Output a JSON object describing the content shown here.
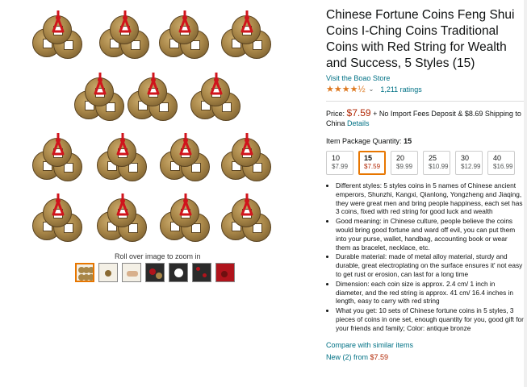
{
  "gallery": {
    "rollover_text": "Roll over image to zoom in",
    "thumbnails": [
      "coins-grid",
      "coin-closeup",
      "coin-hand",
      "coin-dark",
      "coin-yin-yang",
      "coin-scene",
      "coin-red"
    ]
  },
  "product": {
    "title": "Chinese Fortune Coins Feng Shui Coins I-Ching Coins Traditional Coins with Red String for Wealth and Success, 5 Styles (15)",
    "store_link": "Visit the Boao Store",
    "stars": "★★★★½",
    "rating_count": "1,211 ratings"
  },
  "price": {
    "label": "Price:",
    "amount": "$7.59",
    "shipping_text": "+ No Import Fees Deposit & $8.69 Shipping to China",
    "details_link": "Details"
  },
  "quantity": {
    "label": "Item Package Quantity:",
    "selected": "15",
    "options": [
      {
        "qty": "10",
        "price": "$7.99"
      },
      {
        "qty": "15",
        "price": "$7.59"
      },
      {
        "qty": "20",
        "price": "$9.99"
      },
      {
        "qty": "25",
        "price": "$10.99"
      },
      {
        "qty": "30",
        "price": "$12.99"
      },
      {
        "qty": "40",
        "price": "$16.99"
      }
    ]
  },
  "bullets": [
    "Different styles: 5 styles coins in 5 names of Chinese ancient emperors, Shunzhi, Kangxi, Qianlong, Yongzheng and Jiaqing, they were great men and bring people happiness, each set has 3 coins, fixed with red string for good luck and wealth",
    "Good meaning: in Chinese culture, people believe the coins would bring good fortune and ward off evil, you can put them into your purse, wallet, handbag, accounting book or wear them as bracelet, necklace, etc.",
    "Durable material: made of metal alloy material, sturdy and durable, great electroplating on the surface ensures it' not easy to get rust or erosion, can last for a long time",
    "Dimension: each coin size is approx. 2.4 cm/ 1 inch in diameter, and the red string is approx. 41 cm/ 16.4 inches in length, easy to carry with red string",
    "What you get: 10 sets of Chinese fortune coins in 5 styles, 3 pieces of coins in one set, enough quantity for you, good gift for your friends and family; Color: antique bronze"
  ],
  "compare_link": "Compare with similar items",
  "new_from": {
    "text": "New (2) from",
    "price": "$7.59"
  },
  "colors": {
    "accent": "#e77600",
    "link": "#007185",
    "price": "#b12704",
    "star": "#de7921",
    "string": "#d0141c"
  }
}
